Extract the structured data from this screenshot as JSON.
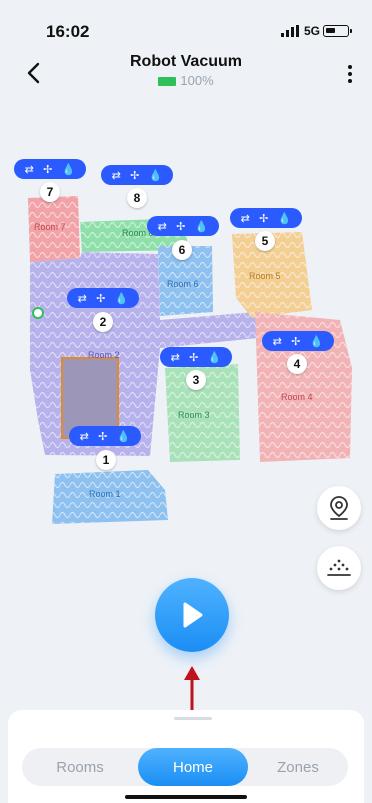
{
  "status_bar": {
    "time": "16:02",
    "network": "5G"
  },
  "header": {
    "title": "Robot Vacuum",
    "battery_text": "100%"
  },
  "rooms": [
    {
      "number": "1",
      "label": "Room 1",
      "color": "#8ec0f0"
    },
    {
      "number": "2",
      "label": "Room 2",
      "color": "#b7b2ec"
    },
    {
      "number": "3",
      "label": "Room 3",
      "color": "#a9e2b8"
    },
    {
      "number": "4",
      "label": "Room 4",
      "color": "#f2b3b7"
    },
    {
      "number": "5",
      "label": "Room 5",
      "color": "#f3cf94"
    },
    {
      "number": "6",
      "label": "Room 6",
      "color": "#8ec0f0"
    },
    {
      "number": "7",
      "label": "Room 7",
      "color": "#f2a3a8"
    },
    {
      "number": "8",
      "label": "Room 8",
      "color": "#8fdfaa"
    }
  ],
  "room_pill_icons": [
    "mode-icon",
    "fan-icon",
    "water-icon"
  ],
  "accent_color": "#2b5bff",
  "tabs": [
    {
      "label": "Rooms",
      "active": false
    },
    {
      "label": "Home",
      "active": true
    },
    {
      "label": "Zones",
      "active": false
    }
  ]
}
